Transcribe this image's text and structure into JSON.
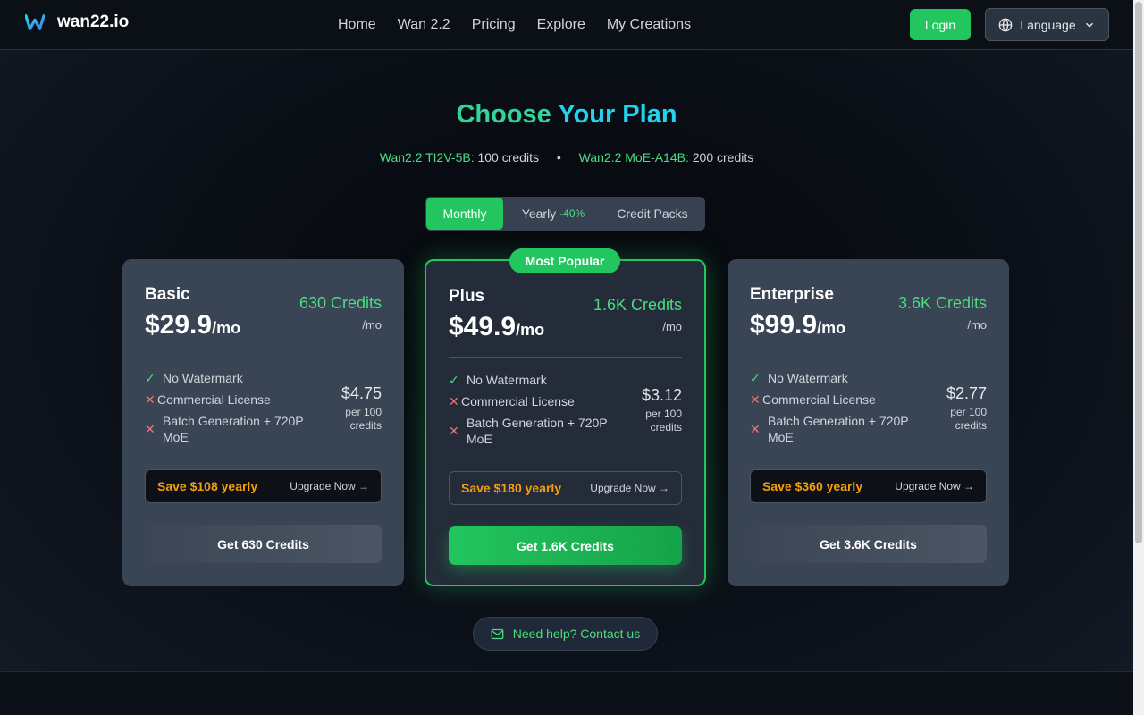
{
  "header": {
    "brand": "wan22.io",
    "nav": [
      "Home",
      "Wan 2.2",
      "Pricing",
      "Explore",
      "My Creations"
    ],
    "login_label": "Login",
    "language_label": "Language"
  },
  "hero": {
    "title_part1": "Choose",
    "title_part2": "Your Plan",
    "model1_name": "Wan2.2 TI2V-5B:",
    "model1_credits": "100 credits",
    "separator": "•",
    "model2_name": "Wan2.2 MoE-A14B:",
    "model2_credits": "200 credits"
  },
  "billing_toggle": {
    "monthly": "Monthly",
    "yearly": "Yearly",
    "yearly_discount": "-40%",
    "credit_packs": "Credit Packs"
  },
  "popular_badge": "Most Popular",
  "plans": [
    {
      "name": "Basic",
      "price": "$29.9",
      "price_unit": "/mo",
      "credits": "630 Credits",
      "credits_unit": "/mo",
      "features": [
        {
          "label": "No Watermark",
          "included": true
        },
        {
          "label": "Commercial License",
          "included": false
        },
        {
          "label": "Batch Generation + 720P MoE",
          "included": false
        }
      ],
      "per100_price": "$4.75",
      "per100_label": "per 100 credits",
      "save_text": "Save $108 yearly",
      "upgrade_text": "Upgrade Now →",
      "cta": "Get 630 Credits"
    },
    {
      "name": "Plus",
      "price": "$49.9",
      "price_unit": "/mo",
      "credits": "1.6K Credits",
      "credits_unit": "/mo",
      "features": [
        {
          "label": "No Watermark",
          "included": true
        },
        {
          "label": "Commercial License",
          "included": false
        },
        {
          "label": "Batch Generation + 720P MoE",
          "included": false
        }
      ],
      "per100_price": "$3.12",
      "per100_label": "per 100 credits",
      "save_text": "Save $180 yearly",
      "upgrade_text": "Upgrade Now →",
      "cta": "Get 1.6K Credits"
    },
    {
      "name": "Enterprise",
      "price": "$99.9",
      "price_unit": "/mo",
      "credits": "3.6K Credits",
      "credits_unit": "/mo",
      "features": [
        {
          "label": "No Watermark",
          "included": true
        },
        {
          "label": "Commercial License",
          "included": false
        },
        {
          "label": "Batch Generation + 720P MoE",
          "included": false
        }
      ],
      "per100_price": "$2.77",
      "per100_label": "per 100 credits",
      "save_text": "Save $360 yearly",
      "upgrade_text": "Upgrade Now →",
      "cta": "Get 3.6K Credits"
    }
  ],
  "help_label": "Need help? Contact us",
  "icons": {
    "logo": "w-logo-icon",
    "language": "globe-icon",
    "chevron": "chevron-down-icon",
    "check": "check-icon",
    "cross": "x-icon",
    "mail": "mail-icon"
  },
  "colors": {
    "accent": "#22c55e",
    "accent_text": "#4ade80",
    "title_cyan": "#22d3ee",
    "save_amber": "#f59e0b",
    "cross_red": "#f87171"
  }
}
